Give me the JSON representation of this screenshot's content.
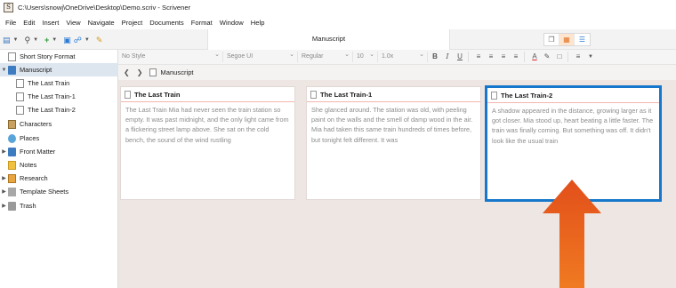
{
  "window": {
    "title": "C:\\Users\\snowj\\OneDrive\\Desktop\\Demo.scriv - Scrivener"
  },
  "menu": [
    "File",
    "Edit",
    "Insert",
    "View",
    "Navigate",
    "Project",
    "Documents",
    "Format",
    "Window",
    "Help"
  ],
  "toolbar": {
    "center_title": "Manuscript"
  },
  "format_bar": {
    "style": "No Style",
    "font": "Segoe UI",
    "weight": "Regular",
    "size": "10",
    "spacing": "1.0x"
  },
  "breadcrumb": {
    "label": "Manuscript"
  },
  "binder": [
    {
      "label": "Short Story Format",
      "icon": "page-icon",
      "indent": 0,
      "caret": ""
    },
    {
      "label": "Manuscript",
      "icon": "folder-icon",
      "indent": 0,
      "caret": "down",
      "selected": true
    },
    {
      "label": "The Last Train",
      "icon": "page-icon",
      "indent": 1,
      "caret": ""
    },
    {
      "label": "The Last Train-1",
      "icon": "page-icon",
      "indent": 1,
      "caret": ""
    },
    {
      "label": "The Last Train-2",
      "icon": "page-icon",
      "indent": 1,
      "caret": ""
    },
    {
      "label": "Characters",
      "icon": "characters-icon",
      "indent": 0,
      "caret": ""
    },
    {
      "label": "Places",
      "icon": "places-icon",
      "indent": 0,
      "caret": ""
    },
    {
      "label": "Front Matter",
      "icon": "folder-icon",
      "indent": 0,
      "caret": "right"
    },
    {
      "label": "Notes",
      "icon": "notes-icon",
      "indent": 0,
      "caret": ""
    },
    {
      "label": "Research",
      "icon": "research-icon",
      "indent": 0,
      "caret": "right"
    },
    {
      "label": "Template Sheets",
      "icon": "template-icon",
      "indent": 0,
      "caret": "right"
    },
    {
      "label": "Trash",
      "icon": "trash-icon",
      "indent": 0,
      "caret": "right"
    }
  ],
  "cards": [
    {
      "title": "The Last Train",
      "body": "The Last Train Mia had never seen the train station so empty. It was past midnight, and the only light came from a flickering street lamp above. She sat on the cold bench, the sound of the wind rustling"
    },
    {
      "title": "The Last Train-1",
      "body": "She glanced around. The station was old, with peeling paint on the walls and the smell of damp wood in the air. Mia had taken this same train hundreds of times before, but tonight felt different. It was"
    },
    {
      "title": "The Last Train-2",
      "body": "A shadow appeared in the distance, growing larger as it got closer. Mia stood up, heart beating a little faster. The train was finally coming. But something was off. It didn't look like the usual train",
      "selected": true
    }
  ],
  "colors": {
    "selection_border": "#1677cc",
    "arrow": "#e8601c",
    "corkboard_bg": "#ede6e3"
  }
}
